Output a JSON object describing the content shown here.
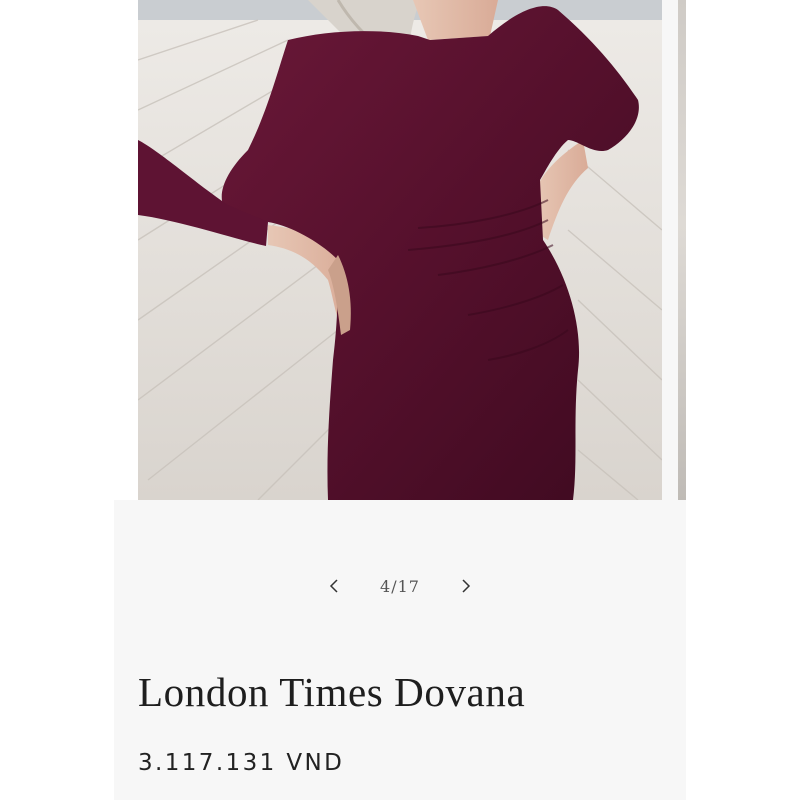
{
  "gallery": {
    "image_description": "product-photo",
    "current_slide": 4,
    "total_slides": 17,
    "counter_text": "4/17"
  },
  "product": {
    "title": "London Times Dovana",
    "price": "3.117.131 VND"
  },
  "colors": {
    "page_background": "#f7f7f7",
    "dress": "#5a1030",
    "deck": "#e6e2dd",
    "text": "#1e1e1e"
  },
  "icons": {
    "prev": "chevron-left-icon",
    "next": "chevron-right-icon"
  }
}
